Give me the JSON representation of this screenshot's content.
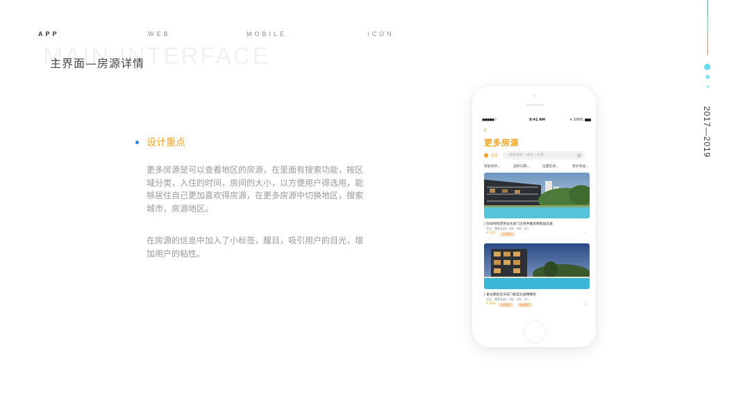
{
  "nav": {
    "app": "APP",
    "web": "WEB",
    "mobile": "MOBILE",
    "icon": "ICON"
  },
  "watermark": "MAIN INTERFACE",
  "page_title": "主界面—房源详情",
  "year_range": "2017—2019",
  "section": {
    "heading": "设计重点",
    "paragraph1": "更多房源是可以查看地区的房源，在里面有搜索功能，按区域分类，入住的时间，房间的大小，以方便用户得选用，能够居住自己更加喜欢得房源，在更多房源中切换地区，搜索城市，房源地区。",
    "paragraph2": "在房源的信息中加入了小标签，醒目，吸引用户的目光，增加用户的粘性。"
  },
  "phone": {
    "status": {
      "signal": "●●●●● ⌔",
      "time": "9:41 AM",
      "battery": "∗ 100%"
    },
    "back": "‹",
    "title": "更多房源",
    "location": "北京",
    "search_placeholder": "搜索地标 / 城市 / 房源",
    "filters": [
      "智能排序⌄",
      "选择日期⌄",
      "位置区域⌄",
      "更多筛选⌄"
    ],
    "listings": [
      {
        "name": "| 四号线和望京站天安门王府井国贸颐和园乌巢",
        "meta": "优品 · 整套出租 · 4居 · 8床 · 8人",
        "price": "¥ 478",
        "tags": [
          "立即预订"
        ],
        "more": "···"
      },
      {
        "name": "| 星光明亮近天安门故宫北海晴朗房",
        "meta": "优品 · 整套出租 · 4居 · 4床 · 4人",
        "price": "¥ 469",
        "tags": [
          "立即预订",
          "自动预订"
        ],
        "more": "···"
      }
    ]
  },
  "colors": {
    "accent": "#f2a321",
    "bullet": "#2a7ef0",
    "deco_dots": "#64d8ef",
    "text_body": "#9a9a9a"
  }
}
